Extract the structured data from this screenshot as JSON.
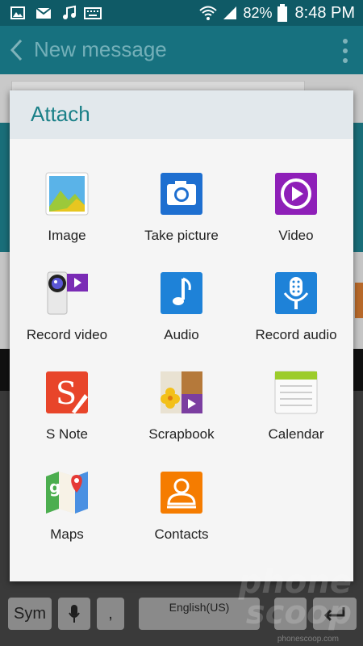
{
  "status_bar": {
    "battery_percent": "82%",
    "time": "8:48 PM",
    "left_icons": [
      "image-notification-icon",
      "gmail-icon",
      "music-icon",
      "keyboard-icon"
    ],
    "right_icons": [
      "wifi-icon",
      "signal-icon",
      "battery-icon"
    ]
  },
  "app_bar": {
    "title": "New message"
  },
  "dialog": {
    "title": "Attach",
    "items": [
      {
        "label": "Image",
        "icon": "image-icon"
      },
      {
        "label": "Take picture",
        "icon": "camera-icon"
      },
      {
        "label": "Video",
        "icon": "video-icon"
      },
      {
        "label": "Record video",
        "icon": "camcorder-icon"
      },
      {
        "label": "Audio",
        "icon": "music-note-icon"
      },
      {
        "label": "Record audio",
        "icon": "microphone-icon"
      },
      {
        "label": "S Note",
        "icon": "s-note-icon"
      },
      {
        "label": "Scrapbook",
        "icon": "scrapbook-icon"
      },
      {
        "label": "Calendar",
        "icon": "calendar-icon"
      },
      {
        "label": "Maps",
        "icon": "maps-icon"
      },
      {
        "label": "Contacts",
        "icon": "contacts-icon"
      }
    ]
  },
  "keyboard": {
    "sym_label": "Sym",
    "comma_label": ",",
    "space_label": "English(US)"
  },
  "watermark": {
    "line1": "phone",
    "line2": "scoop",
    "small": "phonescoop.com"
  },
  "colors": {
    "accent": "#1a8088",
    "app_bar": "#17717f",
    "status_bar": "#0f5a66"
  }
}
